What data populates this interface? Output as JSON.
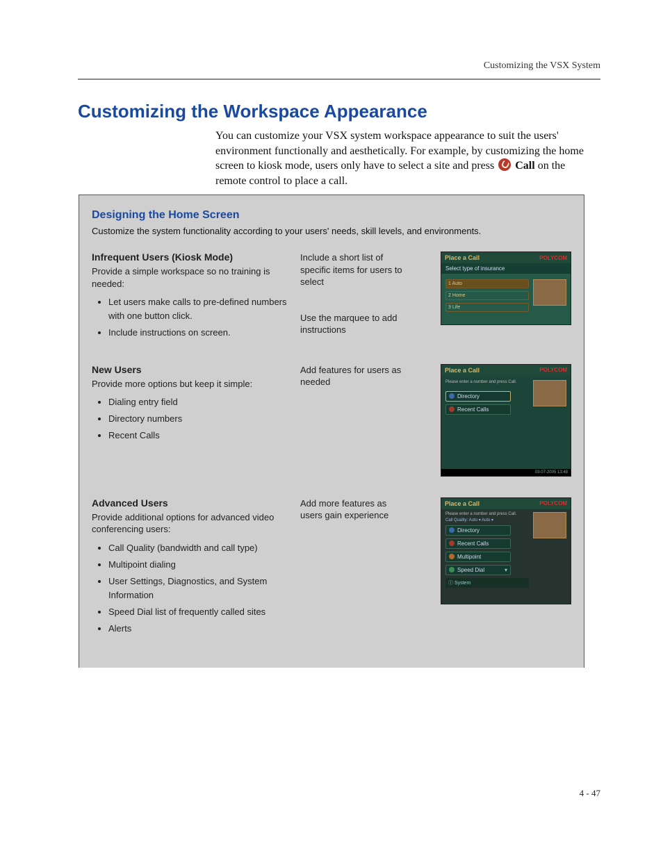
{
  "runningHead": "Customizing the VSX System",
  "pageNumber": "4 - 47",
  "heading": "Customizing the Workspace Appearance",
  "intro": {
    "part1": "You can customize your VSX system workspace appearance to suit the users' environment functionally and aesthetically. For example, by customizing the home screen to kiosk mode, users only have to select a site and press ",
    "callWord": "Call",
    "part2": " on the remote control to place a call."
  },
  "box": {
    "title": "Designing the Home Screen",
    "subtitle": "Customize the system functionality according to your users' needs, skill levels, and environments.",
    "sections": [
      {
        "head": "Infrequent Users (Kiosk Mode)",
        "lead": "Provide a simple workspace so no training is needed:",
        "bullets": [
          "Let users make calls to pre-defined numbers with one button click.",
          "Include instructions on screen."
        ],
        "midTop": "Include a short list of specific items for users to select",
        "midBottom": "Use the marquee to add instructions"
      },
      {
        "head": "New Users",
        "lead": "Provide more options but keep it simple:",
        "bullets": [
          "Dialing entry field",
          "Directory numbers",
          "Recent Calls"
        ],
        "midTop": "Add features for users as needed"
      },
      {
        "head": "Advanced Users",
        "lead": "Provide additional options for advanced video conferencing users:",
        "bullets": [
          "Call Quality (bandwidth and call type)",
          "Multipoint dialing",
          "User Settings, Diagnostics, and System Information",
          "Speed Dial list of frequently called sites",
          "Alerts"
        ],
        "midTop": "Add more features as users gain experience"
      }
    ],
    "shots": {
      "brand": "POLYCOM",
      "title": "Place a Call",
      "a": {
        "banner": "Select type of insurance",
        "options": [
          "1 Auto",
          "2 Home",
          "3 Life"
        ]
      },
      "b": {
        "hint": "Please enter a number and press Call.",
        "items": [
          "Directory",
          "Recent Calls"
        ],
        "timestamp": "03-07-2005 13:48"
      },
      "c": {
        "hint": "Please enter a number and press Call.",
        "quality": "Call Quality:      Auto   ▾   Auto   ▾",
        "items": [
          "Directory",
          "Recent Calls",
          "Multipoint",
          "Speed Dial"
        ],
        "system": "ⓘ  System"
      }
    }
  }
}
